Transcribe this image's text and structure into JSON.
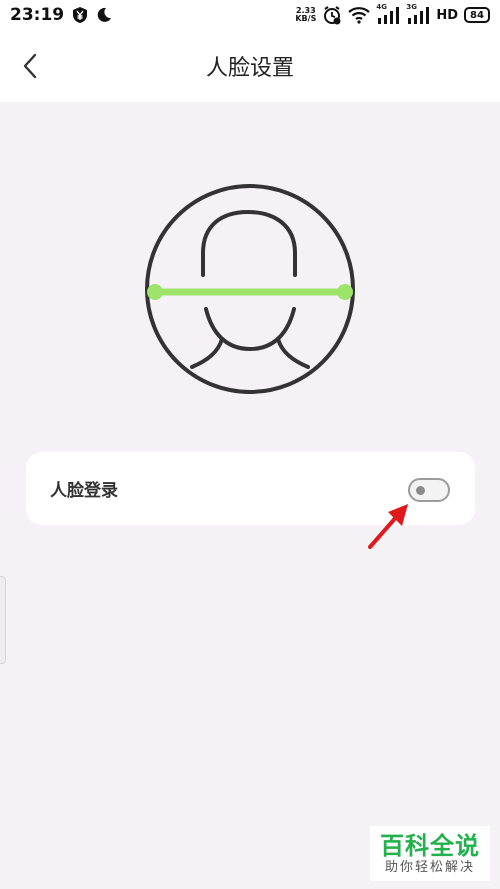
{
  "status_bar": {
    "time": "23:19",
    "net_speed_value": "2.33",
    "net_speed_unit": "KB/S",
    "battery": "84",
    "hd_label": "HD",
    "sim1_label": "4G",
    "sim2_label": "3G"
  },
  "header": {
    "title": "人脸设置"
  },
  "settings": {
    "face_login_label": "人脸登录",
    "face_login_enabled": false
  },
  "watermark": {
    "title": "百科全说",
    "subtitle": "助你轻松解决"
  },
  "colors": {
    "background": "#f4f2f5",
    "scan_line": "#9ee36a",
    "annotation_arrow": "#e0191c",
    "watermark_green": "#23b14d"
  },
  "icons": {
    "back": "chevron-left-icon",
    "illustration": "face-scan-icon"
  }
}
